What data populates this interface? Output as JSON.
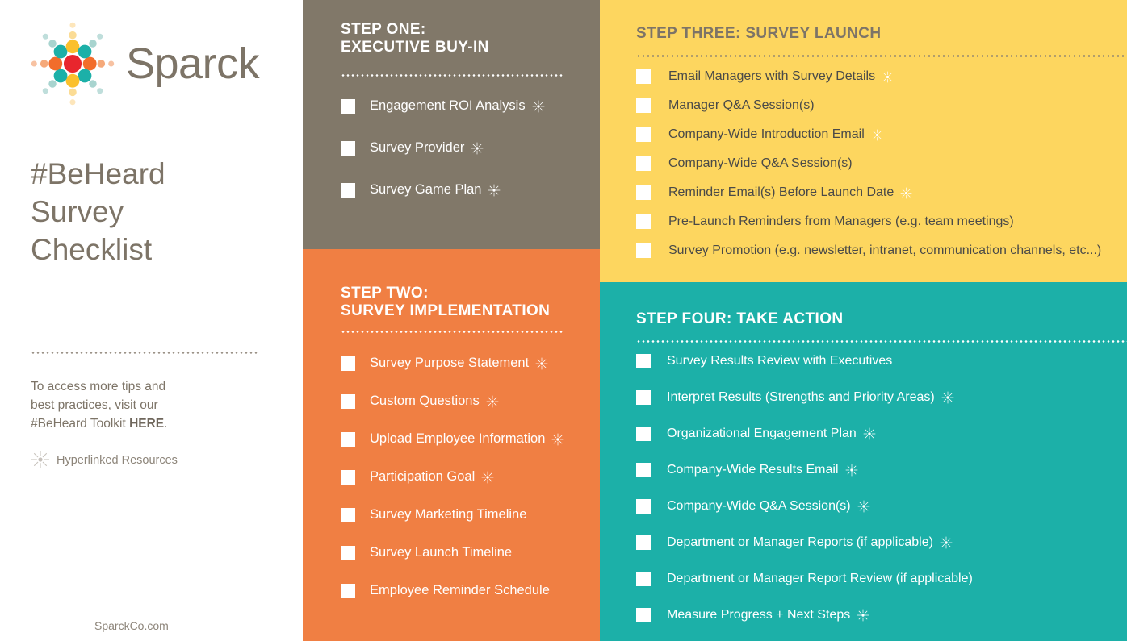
{
  "brand": {
    "name": "Sparck",
    "logo_icon": "sparck-starburst-logo"
  },
  "title": "#BeHeard\nSurvey\nChecklist",
  "blurb": {
    "line1": "To access more tips and",
    "line2": "best practices, visit our",
    "line3_pre": "#BeHeard Toolkit ",
    "link": "HERE",
    "line3_post": "."
  },
  "legend": {
    "icon": "sparkle-icon",
    "label": "Hyperlinked Resources"
  },
  "footer": {
    "site": "SparckCo.com"
  },
  "colors": {
    "step_one_bg": "#817869",
    "step_two_bg": "#f07f43",
    "step_three_bg": "#fdd65f",
    "step_four_bg": "#1cb0a8",
    "brand_brown": "#7d7467",
    "logo_red": "#e8262d",
    "logo_orange": "#f26d2b",
    "logo_teal": "#1cb0a8",
    "logo_yellow": "#fbc02d"
  },
  "steps": [
    {
      "id": "step-one",
      "title_line1": "STEP ONE:",
      "title_line2": "EXECUTIVE BUY-IN",
      "items": [
        {
          "label": "Engagement ROI Analysis",
          "sparkle": true
        },
        {
          "label": "Survey Provider",
          "sparkle": true
        },
        {
          "label": "Survey Game Plan",
          "sparkle": true
        }
      ]
    },
    {
      "id": "step-two",
      "title_line1": "STEP TWO:",
      "title_line2": "SURVEY IMPLEMENTATION",
      "items": [
        {
          "label": "Survey Purpose Statement",
          "sparkle": true
        },
        {
          "label": "Custom Questions",
          "sparkle": true
        },
        {
          "label": "Upload Employee Information",
          "sparkle": true
        },
        {
          "label": "Participation Goal",
          "sparkle": true
        },
        {
          "label": "Survey Marketing Timeline",
          "sparkle": false
        },
        {
          "label": "Survey Launch Timeline",
          "sparkle": false
        },
        {
          "label": "Employee Reminder Schedule",
          "sparkle": false
        }
      ]
    },
    {
      "id": "step-three",
      "title_line1": "STEP THREE: SURVEY LAUNCH",
      "title_line2": "",
      "items": [
        {
          "label": "Email Managers with Survey Details",
          "sparkle": true
        },
        {
          "label": "Manager Q&A Session(s)",
          "sparkle": false
        },
        {
          "label": "Company-Wide Introduction Email",
          "sparkle": true
        },
        {
          "label": "Company-Wide Q&A Session(s)",
          "sparkle": false
        },
        {
          "label": "Reminder Email(s) Before Launch Date",
          "sparkle": true
        },
        {
          "label": "Pre-Launch Reminders from Managers (e.g. team meetings)",
          "sparkle": false
        },
        {
          "label": "Survey Promotion (e.g. newsletter, intranet, communication channels, etc...)",
          "sparkle": false
        }
      ]
    },
    {
      "id": "step-four",
      "title_line1": "STEP FOUR: TAKE ACTION",
      "title_line2": "",
      "items": [
        {
          "label": "Survey Results Review with Executives",
          "sparkle": false
        },
        {
          "label": "Interpret Results (Strengths and Priority Areas)",
          "sparkle": true
        },
        {
          "label": "Organizational Engagement Plan",
          "sparkle": true
        },
        {
          "label": "Company-Wide Results Email",
          "sparkle": true
        },
        {
          "label": "Company-Wide Q&A Session(s)",
          "sparkle": true
        },
        {
          "label": "Department or Manager Reports (if applicable)",
          "sparkle": true
        },
        {
          "label": "Department or Manager Report Review (if applicable)",
          "sparkle": false
        },
        {
          "label": "Measure Progress + Next Steps",
          "sparkle": true
        }
      ]
    }
  ]
}
